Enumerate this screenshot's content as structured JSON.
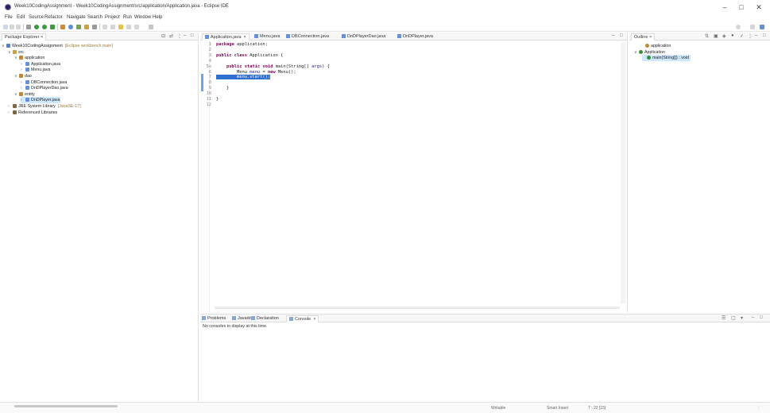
{
  "window": {
    "title": "Week10CodingAssignment - Week10CodingAssignment/src/application/Application.java - Eclipse IDE",
    "minimize": "–",
    "maximize": "□",
    "close": "✕"
  },
  "menubar": {
    "items": [
      "File",
      "Edit",
      "Source",
      "Refactor",
      "Navigate",
      "Search",
      "Project",
      "Run",
      "Window",
      "Help"
    ]
  },
  "package_explorer": {
    "tab_label": "Package Explorer",
    "tab_close": "×",
    "tree": [
      {
        "label": "Week10CodingAssignment",
        "note": "[Eclipse workbench main]",
        "twisty": "∨",
        "icon_color": "#5b7fbf",
        "selected": false
      },
      {
        "label": "src",
        "note": "",
        "twisty": "∨",
        "icon_color": "#c8a24a",
        "selected": false
      },
      {
        "label": "application",
        "note": "",
        "twisty": "∨",
        "icon_color": "#b58b3c",
        "selected": false
      },
      {
        "label": "Application.java",
        "note": "",
        "twisty": "›",
        "icon_color": "#6a8fd6",
        "selected": false
      },
      {
        "label": "Menu.java",
        "note": "",
        "twisty": "›",
        "icon_color": "#6a8fd6",
        "selected": false
      },
      {
        "label": "dao",
        "note": "",
        "twisty": "∨",
        "icon_color": "#b58b3c",
        "selected": false
      },
      {
        "label": "DBConnection.java",
        "note": "",
        "twisty": "›",
        "icon_color": "#6a8fd6",
        "selected": false
      },
      {
        "label": "DnDPlayerDao.java",
        "note": "",
        "twisty": "›",
        "icon_color": "#6a8fd6",
        "selected": false
      },
      {
        "label": "entity",
        "note": "",
        "twisty": "∨",
        "icon_color": "#b58b3c",
        "selected": false
      },
      {
        "label": "DnDPlayer.java",
        "note": "",
        "twisty": "›",
        "icon_color": "#6a8fd6",
        "selected": true
      },
      {
        "label": "JRE System Library",
        "note": "[JavaSE-17]",
        "twisty": "›",
        "icon_color": "#7a6a4a",
        "selected": false
      },
      {
        "label": "Referenced Libraries",
        "note": "",
        "twisty": "›",
        "icon_color": "#7a6a4a",
        "selected": false
      }
    ]
  },
  "editor": {
    "tabs": [
      {
        "label": "Application.java",
        "close": "×",
        "active": true
      },
      {
        "label": "Menu.java",
        "close": "",
        "active": false
      },
      {
        "label": "DBConnection.java",
        "close": "",
        "active": false
      },
      {
        "label": "DnDPlayerDao.java",
        "close": "",
        "active": false
      },
      {
        "label": "DnDPlayer.java",
        "close": "",
        "active": false
      }
    ],
    "lines": [
      {
        "num": "1",
        "code": "package application;"
      },
      {
        "num": "2",
        "code": ""
      },
      {
        "num": "3",
        "code": "public class Application {"
      },
      {
        "num": "4",
        "code": ""
      },
      {
        "num": "5⊖",
        "code": "    public static void main(String[] args) {"
      },
      {
        "num": "6",
        "code": "        Menu menu = new Menu();"
      },
      {
        "num": "7",
        "code": "        menu.start();"
      },
      {
        "num": "8",
        "code": ""
      },
      {
        "num": "9",
        "code": "    }"
      },
      {
        "num": "10",
        "code": ""
      },
      {
        "num": "11",
        "code": "}"
      },
      {
        "num": "12",
        "code": ""
      }
    ],
    "current_line": 7
  },
  "outline": {
    "tab_label": "Outline",
    "tab_close": "×",
    "items": [
      {
        "label": "application",
        "twisty": "",
        "icon_color": "#b58b3c",
        "selected": false
      },
      {
        "label": "Application",
        "twisty": "∨",
        "icon_color": "#3c8d3c",
        "selected": false
      },
      {
        "label": "main(String[]) : void",
        "twisty": "",
        "icon_color": "#3c8d3c",
        "selected": true
      }
    ]
  },
  "bottom": {
    "tabs": [
      {
        "label": "Problems",
        "active": false
      },
      {
        "label": "Javadoc",
        "active": false
      },
      {
        "label": "Declaration",
        "active": false
      },
      {
        "label": "Console",
        "active": true
      }
    ],
    "console_message": "No consoles to display at this time."
  },
  "status": {
    "writable": "Writable",
    "insert_mode": "Smart Insert",
    "position": "7 : 22 [15]"
  },
  "colors": {
    "selection": "#2f6fd0",
    "keyword": "#7f0055"
  }
}
